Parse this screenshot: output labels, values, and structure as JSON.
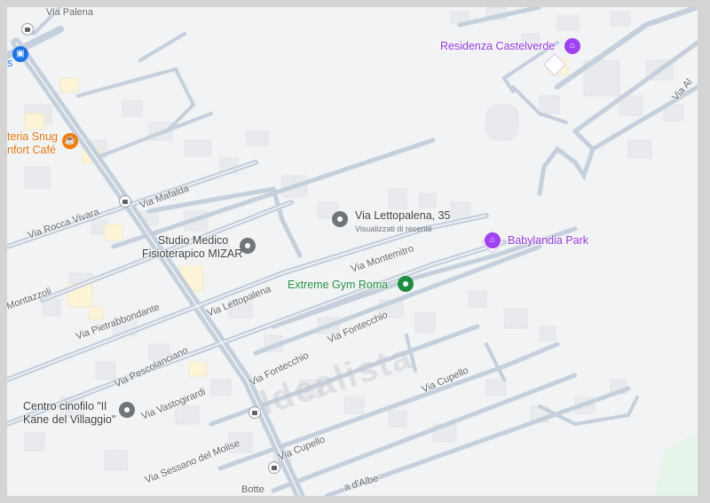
{
  "map": {
    "streets": [
      {
        "id": "via-palena",
        "label": "Via Palena"
      },
      {
        "id": "via-rocca-vivara",
        "label": "Via Rocca Vivara"
      },
      {
        "id": "via-mafalda",
        "label": "Via Mafalda"
      },
      {
        "id": "via-lettopalena",
        "label": "Via Lettopalena"
      },
      {
        "id": "via-montemitro",
        "label": "Via Montemitro"
      },
      {
        "id": "via-montazzoli",
        "label": "Montazzoli"
      },
      {
        "id": "via-pietrabbondante",
        "label": "Via Pietrabbondante"
      },
      {
        "id": "via-pescolanciano",
        "label": "Via Pescolanciano"
      },
      {
        "id": "via-fontecchio-1",
        "label": "Via Fontecchio"
      },
      {
        "id": "via-fontecchio-2",
        "label": "Via Fontecchio"
      },
      {
        "id": "via-vastogirardi",
        "label": "Via Vastogirardi"
      },
      {
        "id": "via-cupello-1",
        "label": "Via Cupello"
      },
      {
        "id": "via-cupello-2",
        "label": "Via Cupello"
      },
      {
        "id": "via-sessano",
        "label": "Via Sessano del Molise"
      },
      {
        "id": "via-botte",
        "label": "Botte"
      },
      {
        "id": "via-albe",
        "label": "a d'Albe"
      },
      {
        "id": "via-al",
        "label": "Via Al"
      }
    ],
    "places": [
      {
        "id": "residenza-castelverde",
        "label": "Residenza Castelverde",
        "icon": "hotel-icon",
        "color": "#9334e6"
      },
      {
        "id": "babylandia-park",
        "label": "Babylandia Park",
        "icon": "park-icon",
        "color": "#9334e6"
      },
      {
        "id": "extreme-gym",
        "label": "Extreme Gym Roma",
        "icon": "gym-icon",
        "color": "#1e8e3e"
      },
      {
        "id": "via-lettopalena-35",
        "label": "Via Lettopalena, 35",
        "sublabel": "Visualizzati di recente",
        "icon": "location-pin-icon",
        "color": "#3c4043"
      },
      {
        "id": "studio-medico",
        "label_line1": "Studio Medico",
        "label_line2": "Fisioterapico MIZAR",
        "icon": "location-pin-icon",
        "color": "#3c4043"
      },
      {
        "id": "centro-cinofilo",
        "label_line1": "Centro cinofilo \"Il",
        "label_line2": "Kane del Villaggio\"",
        "icon": "location-pin-icon",
        "color": "#3c4043"
      },
      {
        "id": "snug-cafe",
        "label_line1": "teria Snug",
        "label_line2": "nfort Café",
        "icon": "coffee-icon",
        "color": "#e8710a"
      },
      {
        "id": "shop-partial",
        "label": "s",
        "icon": "shopping-bag-icon",
        "color": "#1a73e8"
      }
    ],
    "watermark": "Idealista"
  }
}
